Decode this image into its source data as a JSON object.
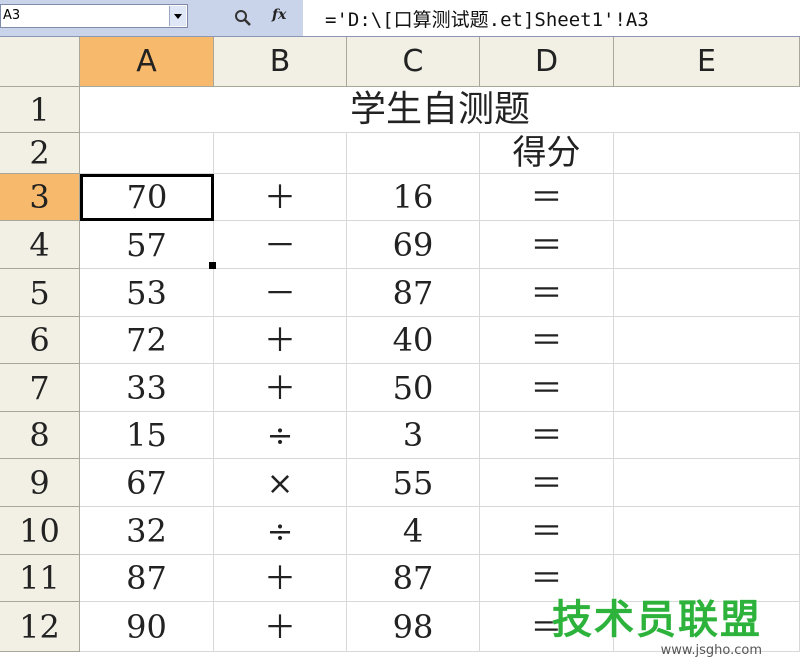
{
  "formula_bar": {
    "name_box": "A3",
    "search_icon": "magnifier-icon",
    "fx_label": "fx",
    "formula": "='D:\\[口算测试题.et]Sheet1'!A3"
  },
  "sheet": {
    "columns": [
      "A",
      "B",
      "C",
      "D",
      "E"
    ],
    "selected_column": "A",
    "rows": [
      "1",
      "2",
      "3",
      "4",
      "5",
      "6",
      "7",
      "8",
      "9",
      "10",
      "11",
      "12"
    ],
    "selected_row": "3",
    "title": "学生自测题",
    "score_header": "得分",
    "problems": [
      {
        "a": "70",
        "op": "＋",
        "c": "16",
        "eq": "＝"
      },
      {
        "a": "57",
        "op": "－",
        "c": "69",
        "eq": "＝"
      },
      {
        "a": "53",
        "op": "－",
        "c": "87",
        "eq": "＝"
      },
      {
        "a": "72",
        "op": "＋",
        "c": "40",
        "eq": "＝"
      },
      {
        "a": "33",
        "op": "＋",
        "c": "50",
        "eq": "＝"
      },
      {
        "a": "15",
        "op": "÷",
        "c": "3",
        "eq": "＝"
      },
      {
        "a": "67",
        "op": "×",
        "c": "55",
        "eq": "＝"
      },
      {
        "a": "32",
        "op": "÷",
        "c": "4",
        "eq": "＝"
      },
      {
        "a": "87",
        "op": "＋",
        "c": "87",
        "eq": "＝"
      },
      {
        "a": "90",
        "op": "＋",
        "c": "98",
        "eq": "＝"
      }
    ]
  },
  "watermark": {
    "main": "技术员联盟",
    "sub": "www.jsgho.com"
  },
  "colors": {
    "header_bg": "#f2f0e4",
    "selected_header_bg": "#f7b96b",
    "toolbar_bg": "#c9d3ea",
    "watermark_green": "#2db33b"
  }
}
